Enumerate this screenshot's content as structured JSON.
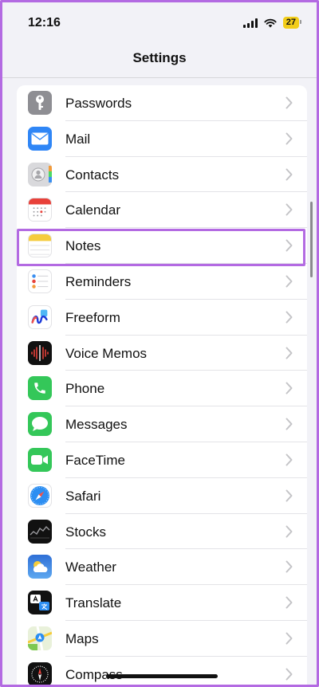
{
  "status": {
    "time": "12:16",
    "battery": "27"
  },
  "nav": {
    "title": "Settings"
  },
  "colors": {
    "accent": "#b36ae2",
    "highlight": "#b36ae2"
  },
  "items": [
    {
      "label": "Passwords",
      "icon": "key-icon",
      "bg": "#8e8e93"
    },
    {
      "label": "Mail",
      "icon": "mail-icon",
      "bg": "#2f86f6"
    },
    {
      "label": "Contacts",
      "icon": "contacts-icon",
      "bg": "#c9c9cc"
    },
    {
      "label": "Calendar",
      "icon": "calendar-icon",
      "bg": "#ffffff"
    },
    {
      "label": "Notes",
      "icon": "notes-icon",
      "bg": "#ffffff"
    },
    {
      "label": "Reminders",
      "icon": "reminders-icon",
      "bg": "#ffffff"
    },
    {
      "label": "Freeform",
      "icon": "freeform-icon",
      "bg": "#ffffff"
    },
    {
      "label": "Voice Memos",
      "icon": "voice-memos-icon",
      "bg": "#111111"
    },
    {
      "label": "Phone",
      "icon": "phone-icon",
      "bg": "#34c759"
    },
    {
      "label": "Messages",
      "icon": "messages-icon",
      "bg": "#34c759"
    },
    {
      "label": "FaceTime",
      "icon": "facetime-icon",
      "bg": "#34c759"
    },
    {
      "label": "Safari",
      "icon": "safari-icon",
      "bg": "#ffffff"
    },
    {
      "label": "Stocks",
      "icon": "stocks-icon",
      "bg": "#111111"
    },
    {
      "label": "Weather",
      "icon": "weather-icon",
      "bg": "#3a83e0"
    },
    {
      "label": "Translate",
      "icon": "translate-icon",
      "bg": "#111111"
    },
    {
      "label": "Maps",
      "icon": "maps-icon",
      "bg": "#e9f1da"
    },
    {
      "label": "Compass",
      "icon": "compass-icon",
      "bg": "#111111"
    }
  ]
}
